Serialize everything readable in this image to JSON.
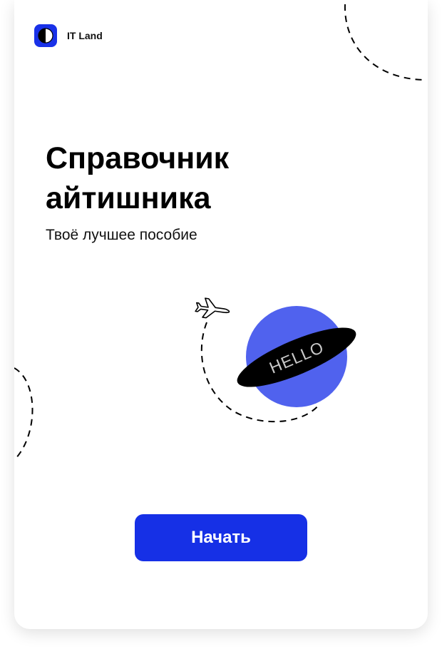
{
  "brand": {
    "name": "IT Land",
    "logo_icon": "half-moon-logo-icon",
    "logo_color": "#1931e8"
  },
  "hero": {
    "title_line1": "Справочник",
    "title_line2": "айтишника",
    "subtitle": "Твоё лучшее пособие"
  },
  "illustration": {
    "planet_color": "#5062ee",
    "ring_color": "#000000",
    "ring_text": "HELLO",
    "ring_text_color": "#c9c9c9",
    "plane_icon": "airplane-icon",
    "orbit_icon": "dashed-orbit"
  },
  "actions": {
    "start_label": "Начать",
    "start_color": "#1630e6"
  },
  "colors": {
    "background": "#ffffff",
    "text": "#000000"
  }
}
